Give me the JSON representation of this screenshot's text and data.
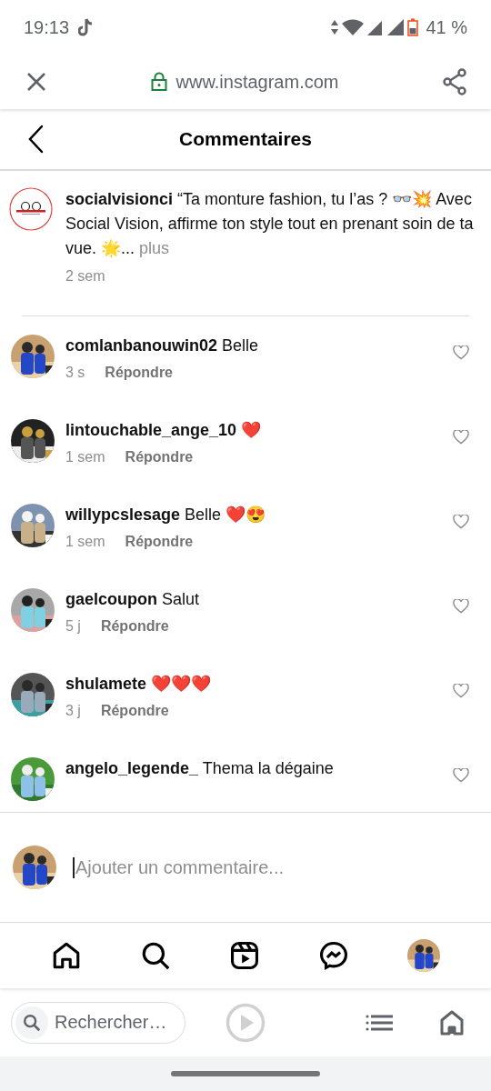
{
  "status_bar": {
    "time": "19:13",
    "battery": "41 %"
  },
  "browser_bar": {
    "url": "www.instagram.com"
  },
  "header": {
    "title": "Commentaires"
  },
  "post": {
    "caption": "**socialvisionci** “Ta monture fashion, tu l’as ? 👓💥 Avec Social Vision, affirme ton style tout en prenant soin de ta vue. 🌟...",
    "more": "plus",
    "time": "2 sem"
  },
  "comments": [
    {
      "text": "**comlanbanouwin02** Belle",
      "time": "3 s",
      "reply": "Répondre",
      "liked": false
    },
    {
      "text": "**lintouchable_ange_10** ❤️",
      "time": "1 sem",
      "reply": "Répondre",
      "liked": false
    },
    {
      "text": "**willypcslesage** Belle ❤️😍",
      "time": "1 sem",
      "reply": "Répondre",
      "liked": false
    },
    {
      "text": "**gaelcoupon** Salut",
      "time": "5 j",
      "reply": "Répondre",
      "liked": false
    },
    {
      "text": "**shulamete** ❤️❤️❤️",
      "time": "3 j",
      "reply": "Répondre",
      "liked": false
    },
    {
      "text": "**angelo_legende_** Thema la dégaine",
      "liked": false
    }
  ],
  "composer": {
    "placeholder": "Ajouter un commentaire..."
  },
  "nav": [
    {
      "kind": "home"
    },
    {
      "kind": "search"
    },
    {
      "kind": "reels"
    },
    {
      "kind": "messenger"
    },
    {
      "kind": "avatar"
    }
  ],
  "browser_footer": {
    "search_placeholder": "Rechercher…"
  }
}
